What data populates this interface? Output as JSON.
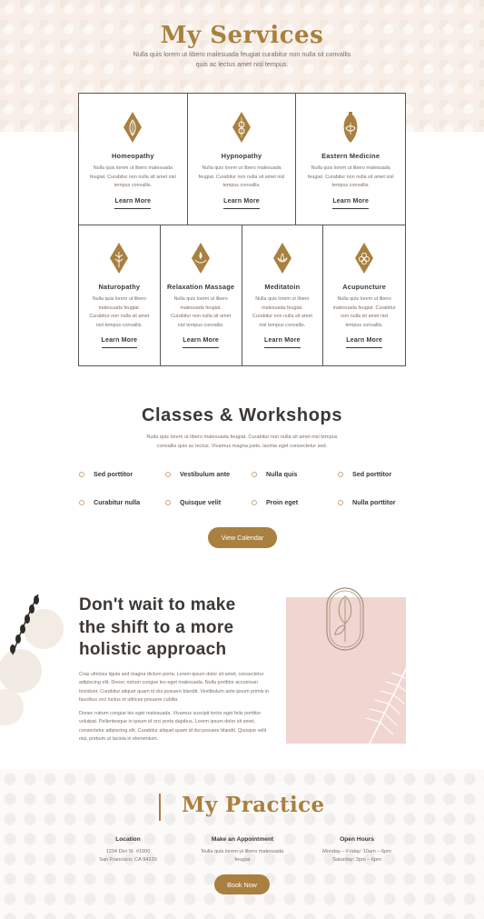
{
  "services": {
    "title": "My Services",
    "subtitle": "Nulla quis lorem ut libero malesuada feugiat curabitur non nulla sit convallis quis ac lectus amet nisl tempus.",
    "top_row": [
      {
        "title": "Homeopathy",
        "text": "Nulla quis lorem ut libero malesuada feugiat. Curabitur non nulla sit amet nisl tempus convallis.",
        "link": "Learn More",
        "icon": "leaf-diamond-icon"
      },
      {
        "title": "Hypnopathy",
        "text": "Nulla quis lorem ut libero malesuada feugiat. Curabitur non nulla sit amet nisl tempus convallis.",
        "link": "Learn More",
        "icon": "spiral-diamond-icon"
      },
      {
        "title": "Eastern Medicine",
        "text": "Nulla quis lorem ut libero malesuada feugiat. Curabitur non nulla sit amet nisl tempus convallis.",
        "link": "Learn More",
        "icon": "lotus-vessel-icon"
      }
    ],
    "bottom_row": [
      {
        "title": "Naturopathy",
        "text": "Nulla quis lorem ut libero malesuada feugiat. Curabitur non nulla sit amet nisl tempus convallis.",
        "link": "Learn More",
        "icon": "leaf-diamond-icon"
      },
      {
        "title": "Relaxation Massage",
        "text": "Nulla quis lorem ut libero malesuada feugiat. Curabitur non nulla sit amet nisl tempus convallis.",
        "link": "Learn More",
        "icon": "hands-diamond-icon"
      },
      {
        "title": "Meditatoin",
        "text": "Nulla quis lorem ut libero malesuada feugiat. Curabitur non nulla sit amet nisl tempus convallis.",
        "link": "Learn More",
        "icon": "lotus-diamond-icon"
      },
      {
        "title": "Acupuncture",
        "text": "Nulla quis lorem ut libero malesuada feugiat. Curabitur non nulla sit amet nisl tempus convallis.",
        "link": "Learn More",
        "icon": "flower-diamond-icon"
      }
    ]
  },
  "classes": {
    "title": "Classes & Workshops",
    "subtitle": "Nulla quis lorem ut libero malesuada feugiat. Curabitur non nulla sit amet nisl tempus convallis quis ac lectus. Vivamus magna justo, lacinia eget consectetur sed.",
    "items": [
      "Sed porttitor",
      "Vestibulum ante",
      "Nulla quis",
      "Sed porttitor",
      "Curabitur nulla",
      "Quisque velit",
      "Proin eget",
      "Nulla porttitor"
    ],
    "button": "View Calendar"
  },
  "holistic": {
    "title": "Don't wait to make the shift to a more holistic approach",
    "paragraph1": "Cras ultricies ligula sed magna dictum porta. Lorem ipsum dolor sit amet, consectetur adipiscing elit. Donec rutrum congue leo eget malesuada. Nulla porttitor accumsan tincidunt. Curabitur aliquet quam id dui posuere blandit. Vestibulum ante ipsum primis in faucibus orci luctus et ultrices posuere cubilia.",
    "paragraph2": "Donec rutrum congue leo eget malesuada. Vivamus suscipit tortor eget felis porttitor volutpat. Pellentesque in ipsum id orci porta dapibus. Lorem ipsum dolor sit amet, consectetur adipiscing elit. Curabitur aliquet quam id dui posuere blandit. Quisque velit nisi, pretium ut lacinia in elementum."
  },
  "practice": {
    "title": "My Practice",
    "location_title": "Location",
    "location_line1": "1234 Divi St. #1000",
    "location_line2": "San Francisco, CA 94220",
    "appointment_title": "Make an Appointment",
    "appointment_line1": "Nulla quis lorem ut libero malesuada",
    "appointment_line2": "feugiat",
    "hours_title": "Open Hours",
    "hours_line1": "Monday – Friday: 10am – 6pm",
    "hours_line2": "Saturday: 3pm – 6pm",
    "button": "Book Now"
  },
  "colors": {
    "accent": "#a9803f",
    "dark_text": "#3d3834",
    "muted_text": "#7b6f66",
    "pink_panel": "#f0d5d0",
    "hero_bg": "#f7efe8"
  }
}
